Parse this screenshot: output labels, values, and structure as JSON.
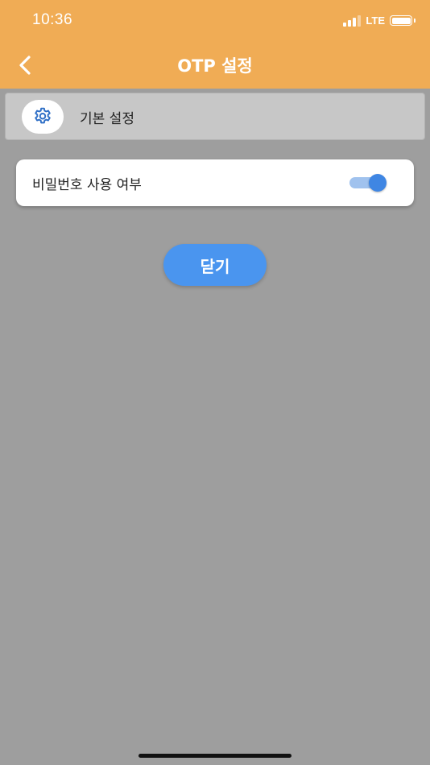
{
  "status_bar": {
    "time": "10:36",
    "network": "LTE"
  },
  "nav": {
    "title": "OTP 설정",
    "back_icon": "chevron-left-icon"
  },
  "section": {
    "icon": "gear-icon",
    "label": "기본 설정"
  },
  "setting": {
    "label": "비밀번호 사용 여부",
    "toggle_on": true
  },
  "close_button": {
    "label": "닫기"
  },
  "colors": {
    "header": "#f0ac55",
    "background": "#9e9e9e",
    "accent": "#4a95ef",
    "toggle_thumb": "#3f86e3",
    "toggle_track": "#a0c2ee"
  }
}
